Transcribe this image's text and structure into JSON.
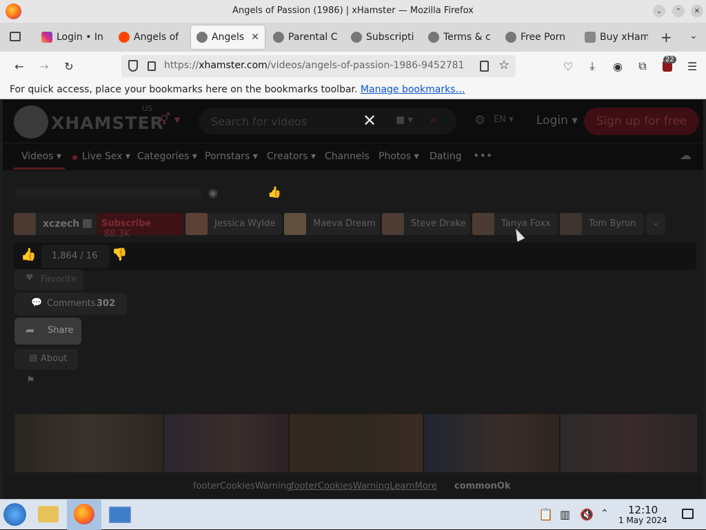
{
  "window": {
    "title": "Angels of Passion (1986) | xHamster — Mozilla Firefox"
  },
  "tabs": [
    {
      "label": "Login • In"
    },
    {
      "label": "Angels of"
    },
    {
      "label": "Angels o"
    },
    {
      "label": "Parental C"
    },
    {
      "label": "Subscripti"
    },
    {
      "label": "Terms & c"
    },
    {
      "label": "Free Porn"
    },
    {
      "label": "Buy xHam"
    }
  ],
  "nav": {
    "url_prefix": "https://",
    "url_domain": "xhamster.com",
    "url_path": "/videos/angels-of-passion-1986-9452781",
    "extension_badge": "22"
  },
  "bookmarks_bar": {
    "message": "For quick access, place your bookmarks here on the bookmarks toolbar.",
    "link": "Manage bookmarks…"
  },
  "site": {
    "logo_text": "XHAMSTER",
    "region": "US",
    "search_placeholder": "Search for videos",
    "language": "EN",
    "login_label": "Login",
    "signup_label": "Sign up for free",
    "menu": [
      "Videos",
      "Live Sex",
      "Categories",
      "Pornstars",
      "Creators",
      "Channels",
      "Photos",
      "Dating"
    ],
    "channel": {
      "name": "xczech",
      "subscribe_label": "Subscribe",
      "subscribers": "88.3K"
    },
    "performers": [
      "Jessica Wylde",
      "Maeva Dream",
      "Steve Drake",
      "Tanya Foxx",
      "Tom Byron"
    ],
    "rating": "1,864 / 16",
    "favorite_label": "Favorite",
    "comments_label": "Comments",
    "comments_count": "302",
    "share_label": "Share",
    "about_label": "About",
    "cookie": {
      "warning": "footerCookiesWarning",
      "learn_more": "footerCookiesWarningLearnMore",
      "ok": "commonOk"
    }
  },
  "taskbar": {
    "time": "12:10",
    "date": "1 May 2024"
  },
  "colors": {
    "accent_red": "#c0303a",
    "link_blue": "#0b57d0",
    "site_bg": "#1a1a1a"
  }
}
